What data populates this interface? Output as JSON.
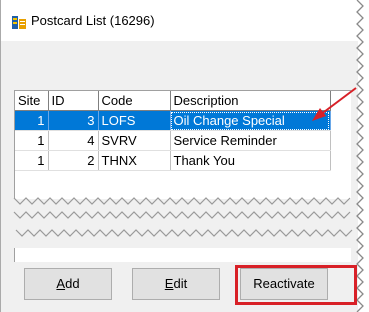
{
  "window": {
    "title": "Postcard List (16296)"
  },
  "table": {
    "columns": [
      "Site",
      "ID",
      "Code",
      "Description"
    ],
    "rows": [
      {
        "site": "1",
        "id": "3",
        "code": "LOFS",
        "description": "Oil Change Special",
        "selected": true
      },
      {
        "site": "1",
        "id": "4",
        "code": "SVRV",
        "description": "Service Reminder",
        "selected": false
      },
      {
        "site": "1",
        "id": "2",
        "code": "THNX",
        "description": "Thank You",
        "selected": false
      }
    ]
  },
  "buttons": {
    "add": {
      "label_mnemonic": "A",
      "label_rest": "dd"
    },
    "edit": {
      "label_mnemonic": "E",
      "label_rest": "dit"
    },
    "reactivate": {
      "label": "Reactivate"
    }
  },
  "colors": {
    "selection": "#0078d7",
    "highlight": "#d82027"
  }
}
